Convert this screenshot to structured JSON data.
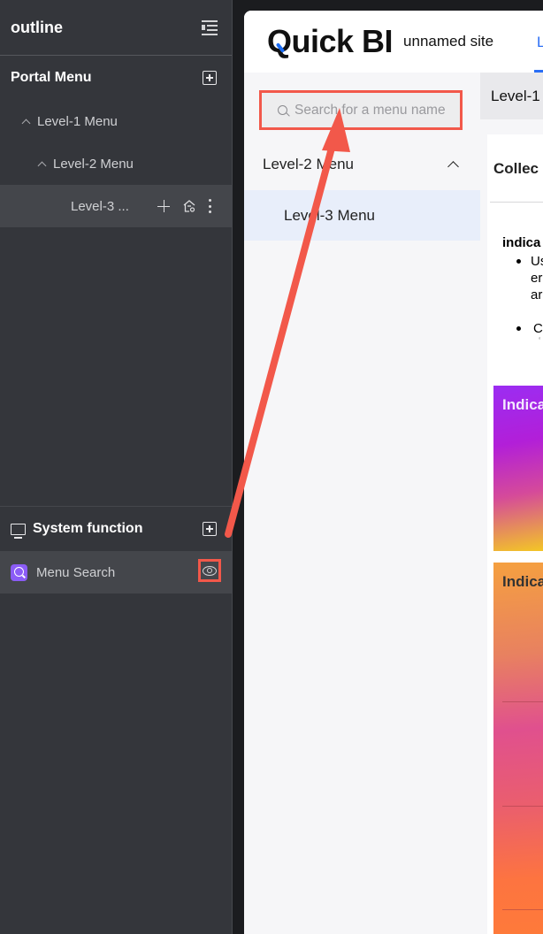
{
  "outline": {
    "title": "outline",
    "collapse_icon": "collapse-outline-icon",
    "portal_menu": {
      "title": "Portal Menu",
      "add_icon": "plus-square-icon",
      "items": [
        {
          "label": "Level-1 Menu",
          "level": 1,
          "expanded": true
        },
        {
          "label": "Level-2 Menu",
          "level": 2,
          "expanded": true
        },
        {
          "label": "Level-3 ...",
          "level": 3,
          "selected": true,
          "actions": [
            "plus-icon",
            "home-settings-icon",
            "more-vertical-icon"
          ]
        }
      ]
    },
    "system_function": {
      "title": "System function",
      "icon": "monitor-icon",
      "add_icon": "plus-square-icon",
      "items": [
        {
          "label": "Menu Search",
          "icon": "search-badge-icon",
          "action_icon": "eye-icon",
          "badge_color": "#8b5cf6"
        }
      ]
    }
  },
  "preview": {
    "logo": "Quick BI",
    "site_name": "unnamed site",
    "nav_tab": "L",
    "search": {
      "placeholder": "Search for a menu name",
      "value": ""
    },
    "menu": {
      "level2": "Level-2 Menu",
      "level3": "Level-3 Menu"
    },
    "breadcrumb": "Level-1",
    "content": {
      "collection_title": "Collec",
      "indicator_heading": "indica",
      "bullets": [
        {
          "lines": [
            "Us",
            "er",
            "ar"
          ]
        },
        {
          "lines": [
            "C"
          ]
        }
      ],
      "cards": [
        {
          "title": "Indica"
        },
        {
          "title": "Indica"
        }
      ]
    }
  },
  "annotation": {
    "color": "#f2584a"
  }
}
